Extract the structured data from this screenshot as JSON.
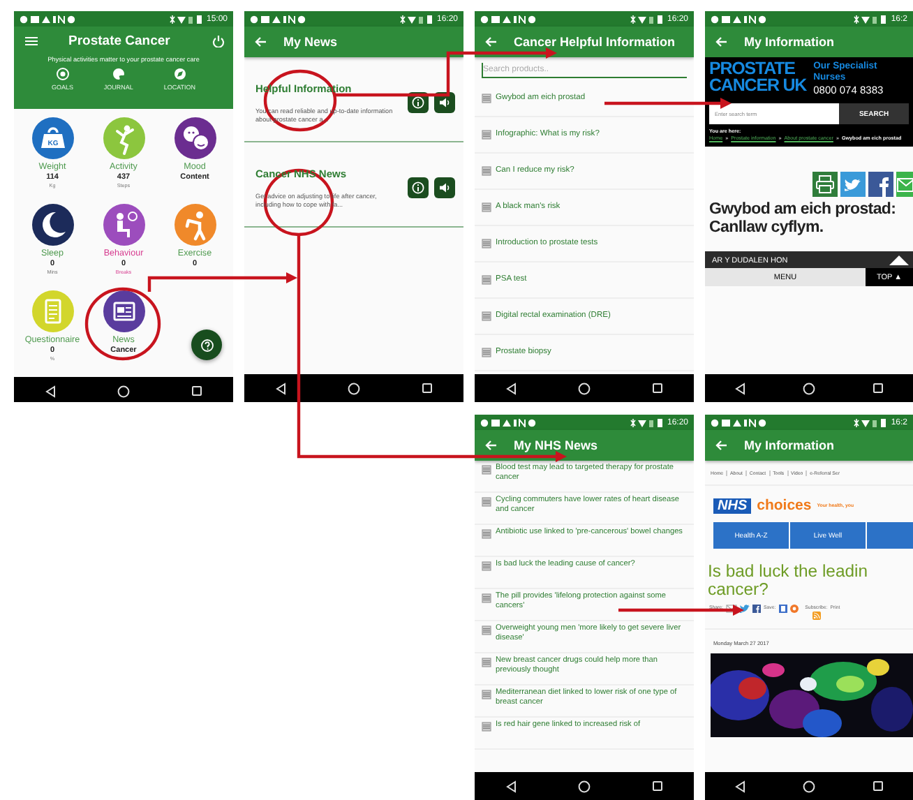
{
  "screens": [
    {
      "kind": "dashboard",
      "time": "15:00",
      "title": "Prostate Cancer",
      "subtitle": "Physical activities matter to your prostate cancer care",
      "shortcuts": [
        {
          "kind": "goals",
          "label": "GOALS"
        },
        {
          "kind": "journal",
          "label": "JOURNAL"
        },
        {
          "kind": "location",
          "label": "LOCATION"
        }
      ],
      "tiles": [
        {
          "kind": "weight",
          "label": "Weight",
          "value": "114",
          "unit": "Kg",
          "color": "#1f6fc1",
          "icon_text": "KG",
          "accented": false
        },
        {
          "kind": "activity",
          "label": "Activity",
          "value": "437",
          "unit": "Steps",
          "color": "#8cc63e",
          "accented": false
        },
        {
          "kind": "mood",
          "label": "Mood",
          "value": "Content",
          "color": "#6b2d90",
          "accented": false
        },
        {
          "kind": "sleep",
          "label": "Sleep",
          "value": "0",
          "unit": "Mins",
          "color": "#1c2b5a",
          "accented": false
        },
        {
          "kind": "behaviour",
          "label": "Behaviour",
          "value": "0",
          "unit": "Breaks",
          "color": "#9c4dbd",
          "accented": true
        },
        {
          "kind": "exercise",
          "label": "Exercise",
          "value": "0",
          "color": "#f0892a",
          "accented": false
        },
        {
          "kind": "questionnaire",
          "label": "Questionnaire",
          "value": "0",
          "unit": "%",
          "color": "#d2d62c",
          "accented": false
        },
        {
          "kind": "news",
          "label": "News",
          "value": "Cancer",
          "color": "#5a3c9e",
          "accented": false
        }
      ]
    },
    {
      "kind": "news",
      "time": "16:20",
      "title": "My News",
      "cards": [
        {
          "title": "Helpful Information",
          "description": "You can read reliable and up-to-date information about prostate cancer a..."
        },
        {
          "title": "Cancer NHS News",
          "description": "Get advice on adjusting to life after cancer, including how to cope with fa..."
        }
      ]
    },
    {
      "kind": "list",
      "time": "16:20",
      "title": "Cancer Helpful Information",
      "search": {
        "placeholder": "Search products.."
      },
      "items": [
        "Gwybod am eich prostad",
        "Infographic: What is my risk?",
        "Can I reduce my risk?",
        "A black man's risk",
        "Introduction to prostate tests",
        "PSA test",
        "Digital rectal examination (DRE)",
        "Prostate biopsy"
      ]
    },
    {
      "kind": "pcuk_page",
      "time": "16:2",
      "title": "My Information",
      "logo_lines": [
        "PROSTATE",
        "CANCER UK"
      ],
      "promo_lines": [
        "Our Specialist",
        "Nurses"
      ],
      "phone": "0800 074 8383",
      "search": {
        "placeholder": "Enter search term",
        "button": "SEARCH"
      },
      "breadcrumb": {
        "label": "You are here:",
        "links": [
          "Home",
          "Prostate information",
          "About prostate cancer"
        ],
        "separator": "»",
        "current": "Gwybod am eich prostad"
      },
      "heading_lines": [
        "Gwybod am eich prostad:",
        "Canllaw cyflym."
      ],
      "section": "AR Y DUDALEN HON",
      "menu_button": "MENU",
      "top_button": "TOP ▲"
    },
    {
      "kind": "list",
      "time": "16:20",
      "title": "My NHS News",
      "items": [
        "Blood test may lead to targeted therapy for prostate cancer",
        "Cycling commuters have lower rates of heart disease and cancer",
        "Antibiotic use linked to 'pre-cancerous' bowel changes",
        "Is bad luck the leading cause of cancer?",
        "The pill provides 'lifelong protection against some cancers'",
        "Overweight young men 'more likely to get severe liver disease'",
        "New breast cancer drugs could help more than previously thought",
        "Mediterranean diet linked to lower risk of one type of breast cancer",
        "Is red hair gene linked to increased risk of"
      ]
    },
    {
      "kind": "nhs_page",
      "time": "16:2",
      "title": "My Information",
      "links": [
        "Home",
        "About",
        "Contact",
        "Tools",
        "Video",
        "e-Referral Ser"
      ],
      "logo": "NHS",
      "site_name": "choices",
      "tagline": "Your health, you",
      "tabs": [
        "Health A-Z",
        "Live Well"
      ],
      "heading_lines": [
        "Is bad luck the leadin",
        "cancer?"
      ],
      "share_label": "Share:",
      "save_label": "Save:",
      "subscribe_label": "Subscribe:",
      "print_label": "Print",
      "date": "Monday March 27 2017"
    }
  ]
}
